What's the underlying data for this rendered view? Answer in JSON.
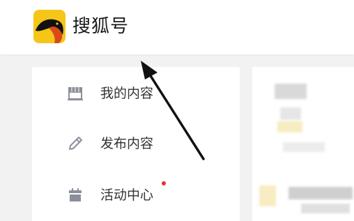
{
  "header": {
    "brand": "搜狐号",
    "logo_icon": "sohu-fox-logo",
    "logo_bg": "#f5c518"
  },
  "sidebar": {
    "items": [
      {
        "label": "我的内容",
        "icon": "store-icon"
      },
      {
        "label": "发布内容",
        "icon": "pencil-icon"
      },
      {
        "label": "活动中心",
        "icon": "calendar-icon",
        "badge_color": "#e5322d"
      }
    ]
  },
  "colors": {
    "background": "#f2f2f2",
    "panel": "#ffffff",
    "icon": "#8a8f99",
    "text": "#333333",
    "arrow": "#111111"
  }
}
